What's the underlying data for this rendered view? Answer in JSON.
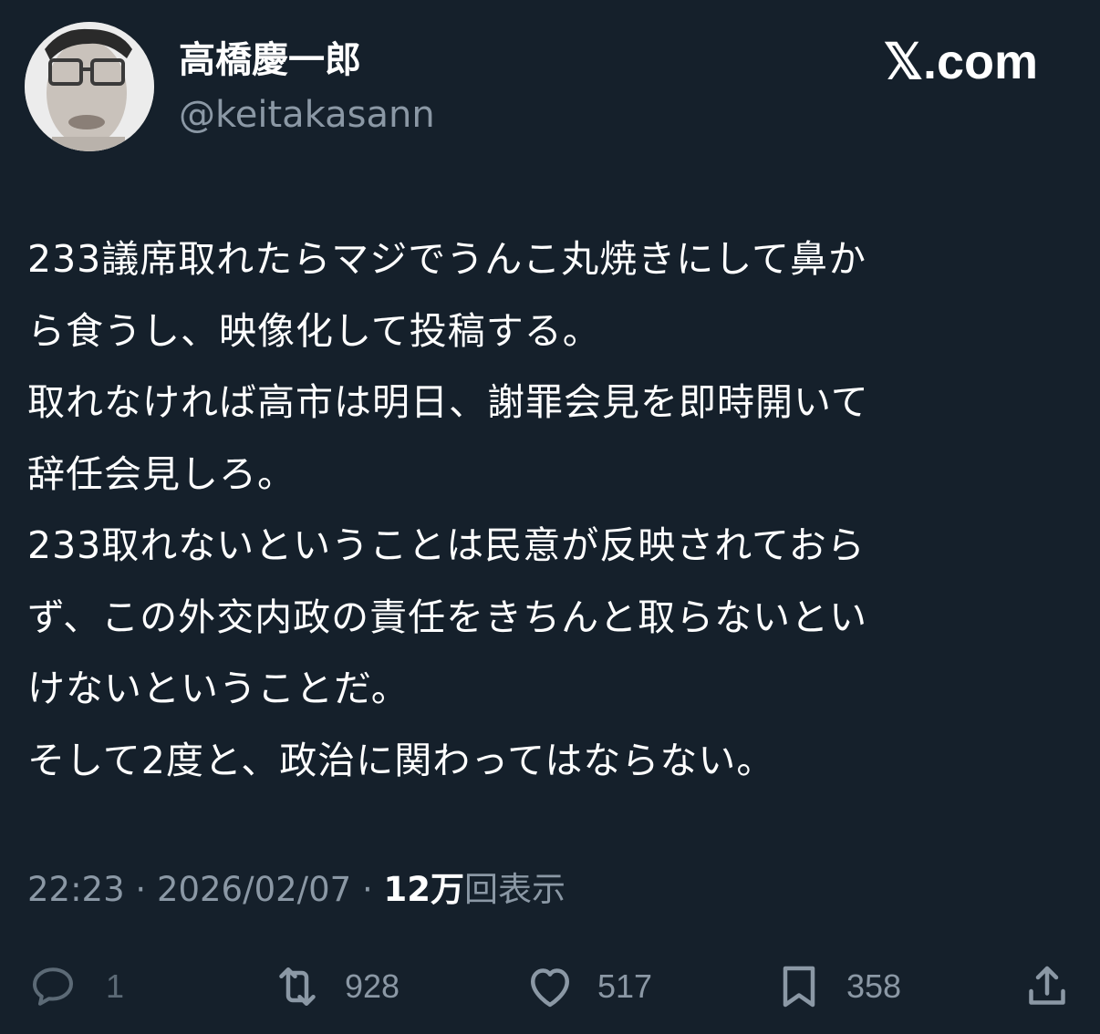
{
  "author": {
    "display_name": "高橋慶一郎",
    "handle": "@keitakasann",
    "avatar_icon": "profile-photo"
  },
  "brand": "𝕏.com",
  "tweet": {
    "lines": [
      "233議席取れたらマジでうんこ丸焼きにして鼻か",
      "ら食うし、映像化して投稿する。",
      "取れなければ高市は明日、謝罪会見を即時開いて",
      "辞任会見しろ。",
      "233取れないということは民意が反映されておら",
      "ず、この外交内政の責任をきちんと取らないとい",
      "けないということだ。",
      "そして2度と、政治に関わってはならない。"
    ]
  },
  "meta": {
    "time": "22:23",
    "separator": " · ",
    "date": "2026/02/07",
    "views_count": "12万",
    "views_label": "回表示"
  },
  "actions": {
    "reply": {
      "icon": "reply-icon",
      "count": "1"
    },
    "retweet": {
      "icon": "retweet-icon",
      "count": "928"
    },
    "like": {
      "icon": "heart-icon",
      "count": "517"
    },
    "bookmark": {
      "icon": "bookmark-icon",
      "count": "358"
    },
    "share": {
      "icon": "share-icon"
    }
  },
  "colors": {
    "background": "#15202b",
    "text": "#ffffff",
    "secondary_text": "#8b98a5"
  }
}
